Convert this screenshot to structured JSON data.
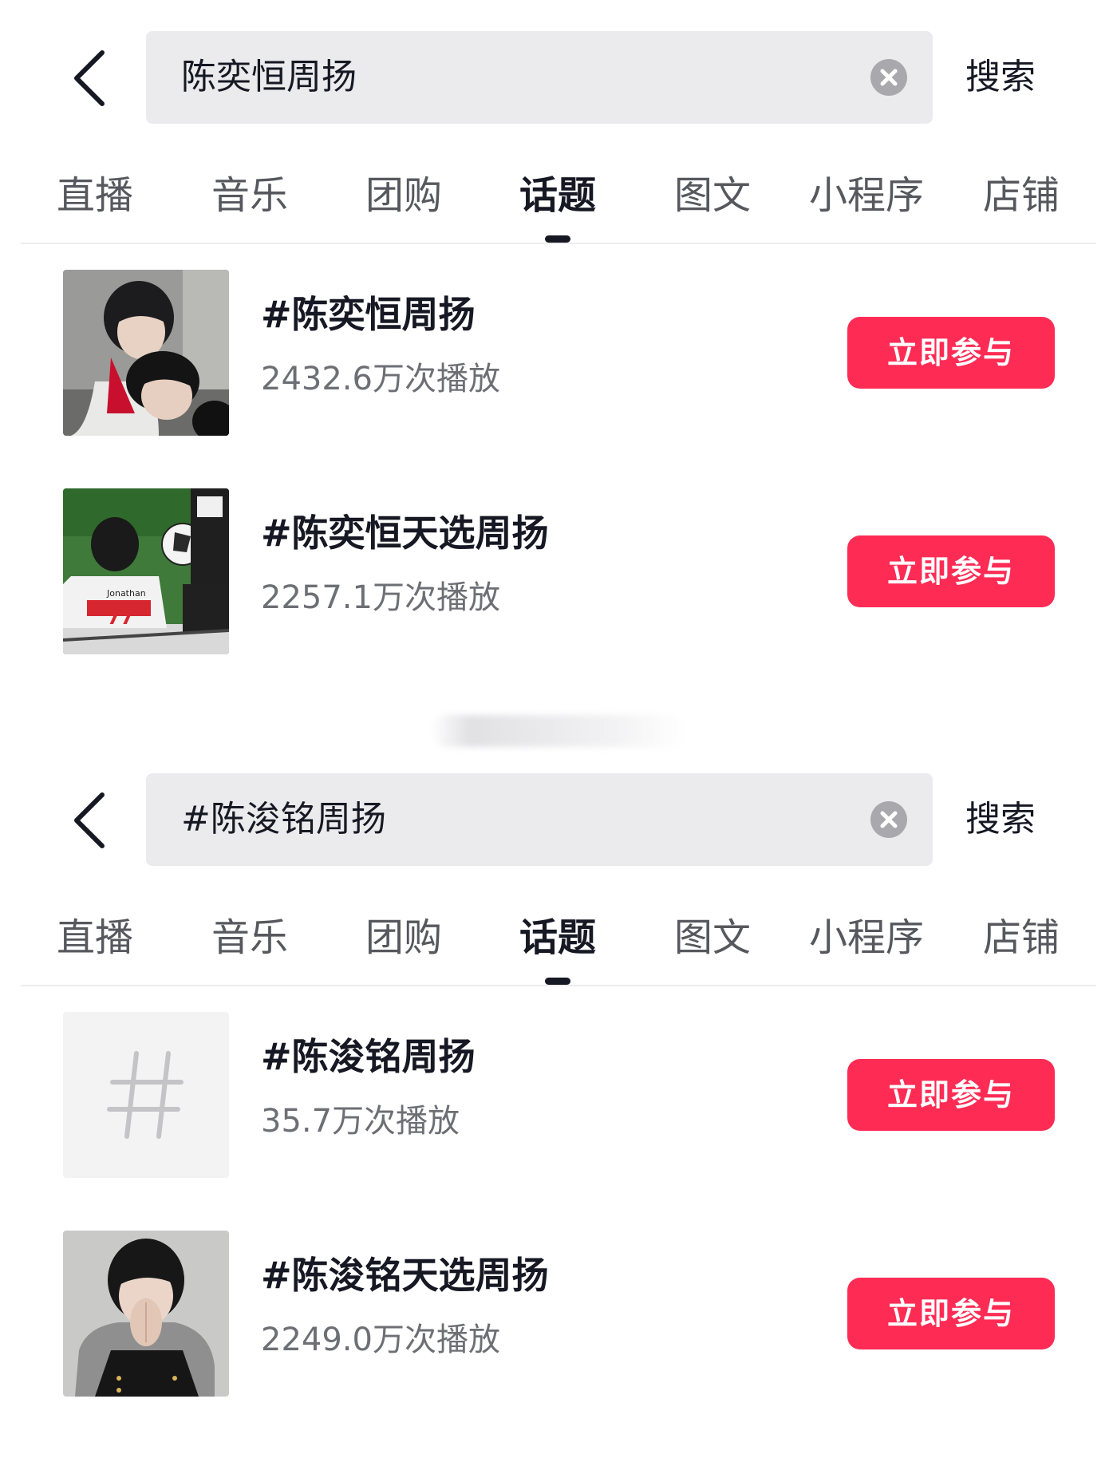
{
  "colors": {
    "accent": "#fe2c55",
    "search_bg": "#ebebed",
    "text_primary": "#161823",
    "text_secondary": "#6e6f75"
  },
  "panels": [
    {
      "search": {
        "query": "陈奕恒周扬",
        "submit_label": "搜索"
      },
      "tabs": [
        {
          "label": "直播"
        },
        {
          "label": "音乐"
        },
        {
          "label": "团购"
        },
        {
          "label": "话题",
          "active": true
        },
        {
          "label": "图文"
        },
        {
          "label": "小程序"
        },
        {
          "label": "店铺"
        }
      ],
      "results": [
        {
          "title": "#陈奕恒周扬",
          "plays": "2432.6万次播放",
          "button": "立即参与",
          "thumbnail": "photo-portrait"
        },
        {
          "title": "#陈奕恒天选周扬",
          "plays": "2257.1万次播放",
          "button": "立即参与",
          "thumbnail": "photo-football"
        }
      ]
    },
    {
      "search": {
        "query": "#陈浚铭周扬",
        "submit_label": "搜索"
      },
      "tabs": [
        {
          "label": "直播"
        },
        {
          "label": "音乐"
        },
        {
          "label": "团购"
        },
        {
          "label": "话题",
          "active": true
        },
        {
          "label": "图文"
        },
        {
          "label": "小程序"
        },
        {
          "label": "店铺"
        }
      ],
      "results": [
        {
          "title": "#陈浚铭周扬",
          "plays": "35.7万次播放",
          "button": "立即参与",
          "thumbnail": "hashtag-icon"
        },
        {
          "title": "#陈浚铭天选周扬",
          "plays": "2249.0万次播放",
          "button": "立即参与",
          "thumbnail": "photo-portrait-hands"
        }
      ]
    }
  ]
}
